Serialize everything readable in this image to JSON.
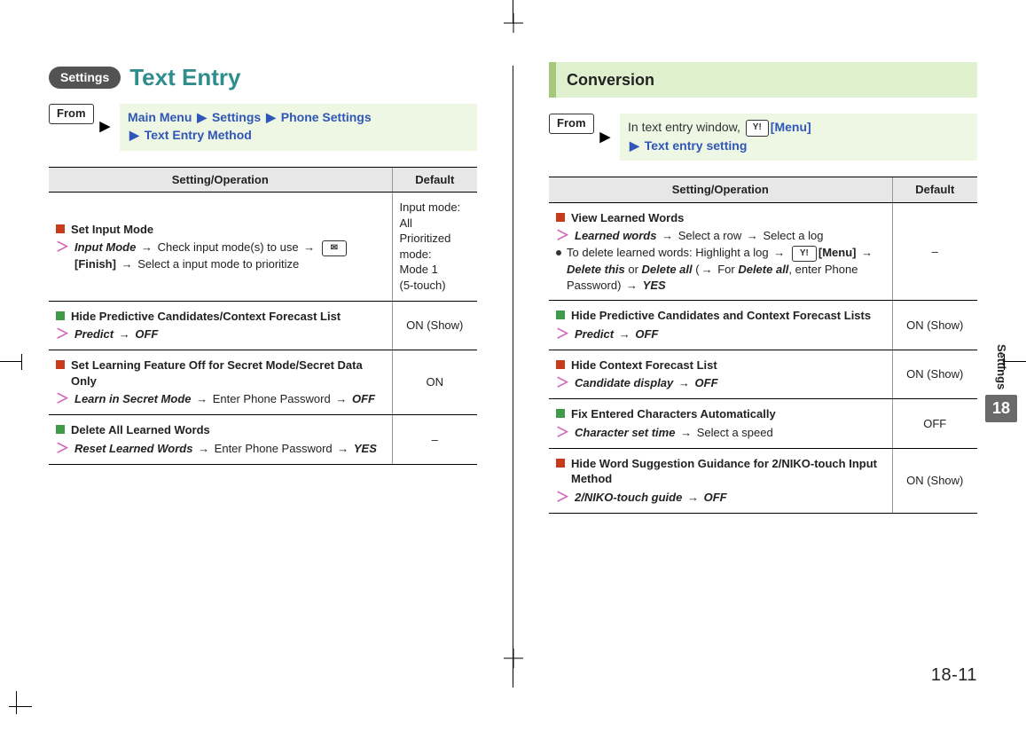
{
  "left": {
    "badge": "Settings",
    "title": "Text Entry",
    "fromLabel": "From",
    "navSegments": [
      "Main Menu",
      "Settings",
      "Phone Settings",
      "Text Entry Method"
    ],
    "headers": {
      "op": "Setting/Operation",
      "def": "Default"
    },
    "rows": [
      {
        "sq": "red",
        "title": "Set Input Mode",
        "stepHTML": "<span class='kw'>Input Mode</span> <span class='arr'>→</span> Check input mode(s) to use <span class='arr'>→</span> <span class='softkey'>✉</span><span class='bracket'>[Finish]</span> <span class='arr'>→</span> Select a input mode to prioritize",
        "default": "Input mode:\nAll\nPrioritized mode:\nMode 1\n(5-touch)"
      },
      {
        "sq": "green",
        "title": "Hide Predictive Candidates/Context Forecast List",
        "stepHTML": "<span class='kw'>Predict</span> <span class='arr'>→</span> <span class='kw'>OFF</span>",
        "default": "ON (Show)"
      },
      {
        "sq": "red",
        "title": "Set Learning Feature Off for Secret Mode/Secret Data Only",
        "stepHTML": "<span class='kw'>Learn in Secret Mode</span> <span class='arr'>→</span> Enter Phone Password <span class='arr'>→</span> <span class='kw'>OFF</span>",
        "default": "ON"
      },
      {
        "sq": "green",
        "title": "Delete All Learned Words",
        "stepHTML": "<span class='kw'>Reset Learned Words</span> <span class='arr'>→</span> Enter Phone Password <span class='arr'>→</span> <span class='kw'>YES</span>",
        "default": "–"
      }
    ]
  },
  "right": {
    "heading": "Conversion",
    "fromLabel": "From",
    "navPlainPrefix": "In text entry window, ",
    "navKeyGlyph": "Y!",
    "navKeyLabel": "[Menu]",
    "navLine2": "Text entry setting",
    "headers": {
      "op": "Setting/Operation",
      "def": "Default"
    },
    "rows": [
      {
        "sq": "red",
        "title": "View Learned Words",
        "stepHTML": "<span class='kw'>Learned words</span> <span class='arr'>→</span> Select a row <span class='arr'>→</span> Select a log",
        "bulletHTML": "To delete learned words: Highlight a log <span class='arr'>→</span> <span class='softkey'>Y!</span><span class='bracket'>[Menu]</span> <span class='arr'>→</span> <span class='kw'>Delete this</span> or <span class='kw'>Delete all</span> (<span class='arr'>→</span> For <span class='kw'>Delete all</span>, enter Phone Password) <span class='arr'>→</span> <span class='kw'>YES</span>",
        "default": "–"
      },
      {
        "sq": "green",
        "title": "Hide Predictive Candidates and Context Forecast Lists",
        "stepHTML": "<span class='kw'>Predict</span> <span class='arr'>→</span> <span class='kw'>OFF</span>",
        "default": "ON (Show)"
      },
      {
        "sq": "red",
        "title": "Hide Context Forecast List",
        "stepHTML": "<span class='kw'>Candidate display</span> <span class='arr'>→</span> <span class='kw'>OFF</span>",
        "default": "ON (Show)"
      },
      {
        "sq": "green",
        "title": "Fix Entered Characters Automatically",
        "stepHTML": "<span class='kw'>Character set time</span> <span class='arr'>→</span> Select a speed",
        "default": "OFF"
      },
      {
        "sq": "red",
        "title": "Hide Word Suggestion Guidance for 2/NIKO-touch Input Method",
        "stepHTML": "<span class='kw'>2/NIKO-touch guide</span> <span class='arr'>→</span> <span class='kw'>OFF</span>",
        "default": "ON (Show)"
      }
    ]
  },
  "thumb": {
    "word": "Settings",
    "number": "18"
  },
  "pageNum": "18-11"
}
